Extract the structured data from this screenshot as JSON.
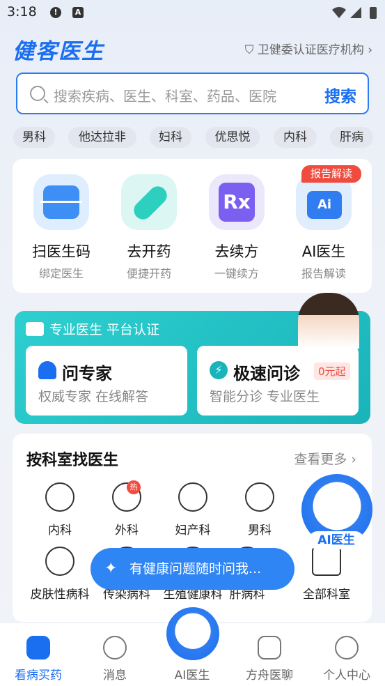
{
  "status": {
    "time": "3:18"
  },
  "brand": "健客医生",
  "cert": "卫健委认证医疗机构",
  "search": {
    "placeholder": "搜索疾病、医生、科室、药品、医院",
    "button": "搜索"
  },
  "tags": [
    "男科",
    "他达拉非",
    "妇科",
    "优思悦",
    "内科",
    "肝病"
  ],
  "quick": {
    "badge": "报告解读",
    "items": [
      {
        "title": "扫医生码",
        "sub": "绑定医生"
      },
      {
        "title": "去开药",
        "sub": "便捷开药"
      },
      {
        "title": "去续方",
        "sub": "一键续方"
      },
      {
        "title": "AI医生",
        "sub": "报告解读"
      }
    ]
  },
  "consult": {
    "header": "专业医生 平台认证",
    "left": {
      "title": "问专家",
      "sub": "权威专家 在线解答"
    },
    "right": {
      "title": "极速问诊",
      "sub": "智能分诊 专业医生",
      "price": "0元起"
    }
  },
  "dept": {
    "title": "按科室找医生",
    "more": "查看更多",
    "hot": "热",
    "items": [
      "内科",
      "外科",
      "妇产科",
      "男科",
      "皮肤性病科",
      "传染病科",
      "生殖健康科",
      "肝病科",
      "全部科室"
    ]
  },
  "ai_float": "AI医生",
  "prompt": "有健康问题随时问我...",
  "nav": [
    "看病买药",
    "消息",
    "AI医生",
    "方舟医聊",
    "个人中心"
  ]
}
